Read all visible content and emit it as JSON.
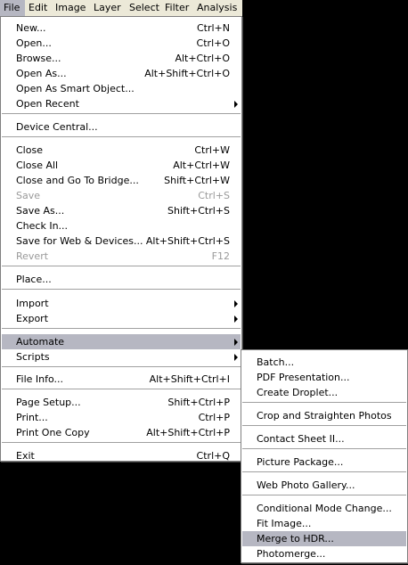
{
  "menubar": {
    "items": [
      "File",
      "Edit",
      "Image",
      "Layer",
      "Select",
      "Filter",
      "Analysis"
    ]
  },
  "file_menu": {
    "items": [
      {
        "label": "New...",
        "shortcut": "Ctrl+N"
      },
      {
        "label": "Open...",
        "shortcut": "Ctrl+O"
      },
      {
        "label": "Browse...",
        "shortcut": "Alt+Ctrl+O"
      },
      {
        "label": "Open As...",
        "shortcut": "Alt+Shift+Ctrl+O"
      },
      {
        "label": "Open As Smart Object...",
        "shortcut": ""
      },
      {
        "label": "Open Recent",
        "shortcut": ""
      },
      {
        "label": "Device Central...",
        "shortcut": ""
      },
      {
        "label": "Close",
        "shortcut": "Ctrl+W"
      },
      {
        "label": "Close All",
        "shortcut": "Alt+Ctrl+W"
      },
      {
        "label": "Close and Go To Bridge...",
        "shortcut": "Shift+Ctrl+W"
      },
      {
        "label": "Save",
        "shortcut": "Ctrl+S"
      },
      {
        "label": "Save As...",
        "shortcut": "Shift+Ctrl+S"
      },
      {
        "label": "Check In...",
        "shortcut": ""
      },
      {
        "label": "Save for Web & Devices...",
        "shortcut": "Alt+Shift+Ctrl+S"
      },
      {
        "label": "Revert",
        "shortcut": "F12"
      },
      {
        "label": "Place...",
        "shortcut": ""
      },
      {
        "label": "Import",
        "shortcut": ""
      },
      {
        "label": "Export",
        "shortcut": ""
      },
      {
        "label": "Automate",
        "shortcut": ""
      },
      {
        "label": "Scripts",
        "shortcut": ""
      },
      {
        "label": "File Info...",
        "shortcut": "Alt+Shift+Ctrl+I"
      },
      {
        "label": "Page Setup...",
        "shortcut": "Shift+Ctrl+P"
      },
      {
        "label": "Print...",
        "shortcut": "Ctrl+P"
      },
      {
        "label": "Print One Copy",
        "shortcut": "Alt+Shift+Ctrl+P"
      },
      {
        "label": "Exit",
        "shortcut": "Ctrl+Q"
      }
    ]
  },
  "automate_menu": {
    "items": [
      "Batch...",
      "PDF Presentation...",
      "Create Droplet...",
      "Crop and Straighten Photos",
      "Contact Sheet II...",
      "Picture Package...",
      "Web Photo Gallery...",
      "Conditional Mode Change...",
      "Fit Image...",
      "Merge to HDR...",
      "Photomerge..."
    ]
  },
  "colors": {
    "highlight": "#b6b7c2",
    "disabled_text": "#9a9a9a",
    "menubar_bg": "#ece9d8"
  }
}
